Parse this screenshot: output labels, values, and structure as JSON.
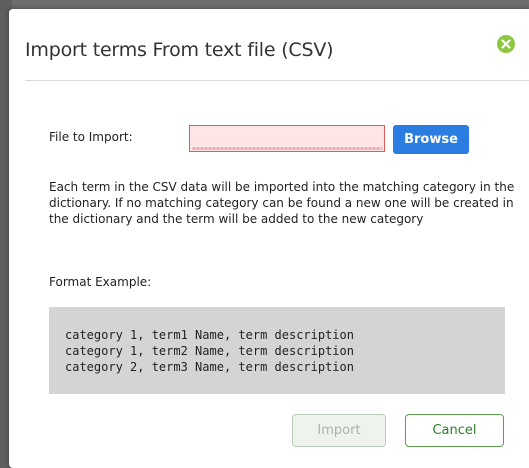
{
  "dialog": {
    "title": "Import terms From text file (CSV)",
    "close_icon": "close-circle-icon"
  },
  "form": {
    "file_label": "File to Import:",
    "file_value": "",
    "browse_label": "Browse"
  },
  "description": "Each term in the CSV data will be imported into the matching category in the dictionary. If no matching category can be found a new one will be created in the dictionary and the term will be added to the new category",
  "format": {
    "label": "Format Example:",
    "lines": [
      "category 1, term1 Name, term description",
      "category 1, term2 Name, term description",
      "category 2, term3 Name, term description"
    ]
  },
  "buttons": {
    "import_label": "Import",
    "cancel_label": "Cancel"
  },
  "colors": {
    "accent_blue": "#2b7de1",
    "accent_green": "#8dc63f",
    "error_red": "#e35a5a"
  }
}
